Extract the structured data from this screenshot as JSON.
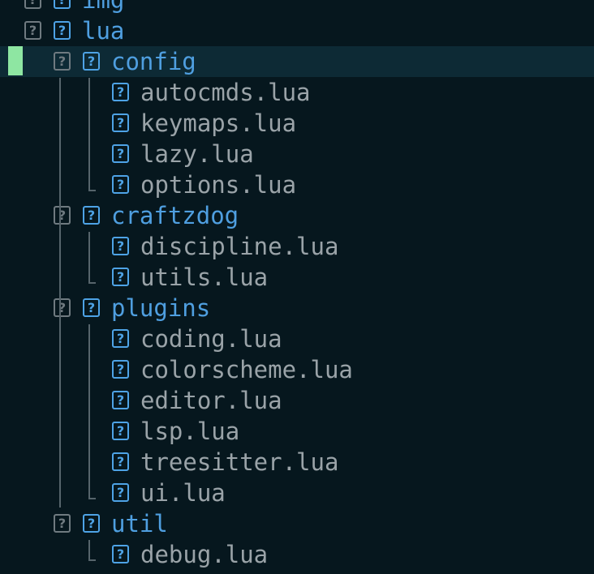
{
  "colors": {
    "background": "#06171e",
    "cursor_line": "#0d2a35",
    "sign_column_marker": "#8ee6a2",
    "directory": "#4f9fe0",
    "file": "#9aa3a8",
    "fold_icon": "#6f7a80",
    "indent_guide": "#56646b"
  },
  "tree": {
    "missing_glyph": "?",
    "items": [
      {
        "name": "img",
        "type": "directory",
        "depth": 0
      },
      {
        "name": "lua",
        "type": "directory",
        "depth": 0
      },
      {
        "name": "config",
        "type": "directory",
        "depth": 1,
        "cursor": true,
        "marker": true
      },
      {
        "name": "autocmds.lua",
        "type": "file",
        "depth": 2
      },
      {
        "name": "keymaps.lua",
        "type": "file",
        "depth": 2
      },
      {
        "name": "lazy.lua",
        "type": "file",
        "depth": 2
      },
      {
        "name": "options.lua",
        "type": "file",
        "depth": 2
      },
      {
        "name": "craftzdog",
        "type": "directory",
        "depth": 1
      },
      {
        "name": "discipline.lua",
        "type": "file",
        "depth": 2
      },
      {
        "name": "utils.lua",
        "type": "file",
        "depth": 2
      },
      {
        "name": "plugins",
        "type": "directory",
        "depth": 1
      },
      {
        "name": "coding.lua",
        "type": "file",
        "depth": 2
      },
      {
        "name": "colorscheme.lua",
        "type": "file",
        "depth": 2
      },
      {
        "name": "editor.lua",
        "type": "file",
        "depth": 2
      },
      {
        "name": "lsp.lua",
        "type": "file",
        "depth": 2
      },
      {
        "name": "treesitter.lua",
        "type": "file",
        "depth": 2
      },
      {
        "name": "ui.lua",
        "type": "file",
        "depth": 2
      },
      {
        "name": "util",
        "type": "directory",
        "depth": 1
      },
      {
        "name": "debug.lua",
        "type": "file",
        "depth": 2
      }
    ]
  }
}
